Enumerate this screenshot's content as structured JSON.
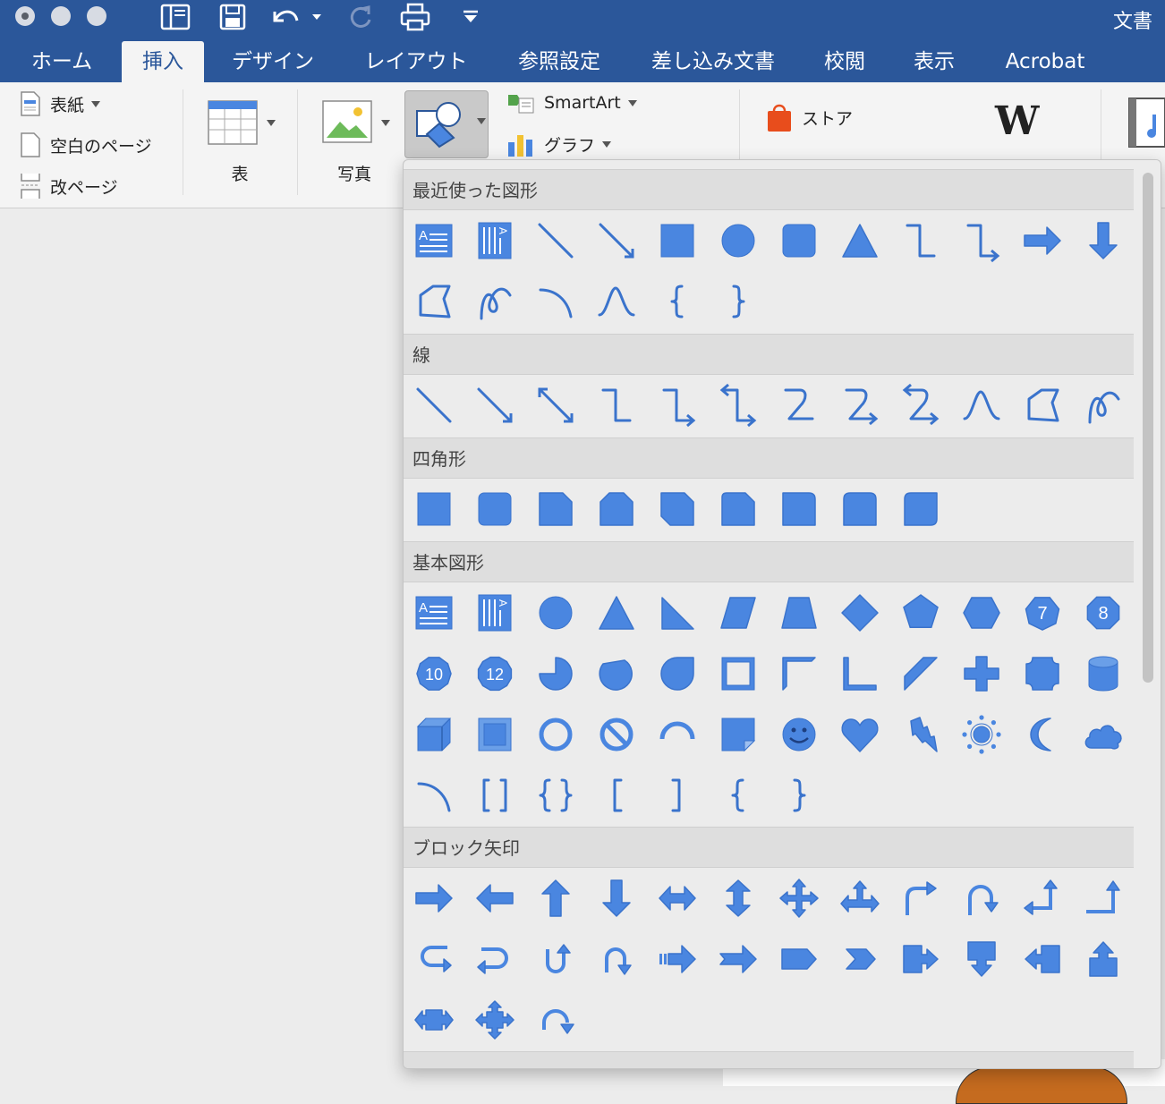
{
  "window": {
    "title": "文書"
  },
  "quick_access": [
    {
      "icon": "sidebar-icon"
    },
    {
      "icon": "save-icon"
    },
    {
      "icon": "undo-icon"
    },
    {
      "icon": "undo-dropdown-icon"
    },
    {
      "icon": "redo-icon"
    },
    {
      "icon": "print-icon"
    },
    {
      "icon": "customize-dropdown-icon"
    }
  ],
  "tabs": [
    {
      "label": "ホーム"
    },
    {
      "label": "挿入",
      "active": true
    },
    {
      "label": "デザイン"
    },
    {
      "label": "レイアウト"
    },
    {
      "label": "参照設定"
    },
    {
      "label": "差し込み文書"
    },
    {
      "label": "校閲"
    },
    {
      "label": "表示"
    },
    {
      "label": "Acrobat"
    }
  ],
  "ribbon": {
    "cover_page": "表紙",
    "blank_page": "空白のページ",
    "page_break": "改ページ",
    "table": "表",
    "picture": "写真",
    "smartart": "SmartArt",
    "chart": "グラフ",
    "store": "ストア"
  },
  "colors": {
    "titlebar": "#2b579a",
    "shape_fill": "#4a86e0",
    "shape_stroke": "#3a73cc"
  },
  "gallery": {
    "sections": [
      {
        "title": "最近使った図形",
        "shapes": [
          "text-box",
          "vertical-text-box",
          "line",
          "line-arrow",
          "rectangle",
          "oval",
          "rounded-rectangle",
          "triangle",
          "elbow-connector",
          "elbow-arrow-connector",
          "right-arrow",
          "down-arrow",
          "freeform",
          "scribble",
          "arc",
          "wave-curve",
          "left-brace",
          "right-brace"
        ]
      },
      {
        "title": "線",
        "shapes": [
          "line",
          "line-arrow",
          "line-double-arrow",
          "elbow-connector",
          "elbow-arrow-connector",
          "elbow-double-arrow-connector",
          "curved-connector",
          "curved-arrow-connector",
          "curved-double-arrow-connector",
          "curve",
          "freeform",
          "scribble"
        ]
      },
      {
        "title": "四角形",
        "shapes": [
          "rectangle",
          "rounded-rectangle",
          "snip-single-corner-rectangle",
          "snip-same-side-corner-rectangle",
          "snip-diagonal-corner-rectangle",
          "snip-round-single-corner-rectangle",
          "round-single-corner-rectangle",
          "round-same-side-corner-rectangle",
          "round-diagonal-corner-rectangle"
        ]
      },
      {
        "title": "基本図形",
        "shapes": [
          "text-box",
          "vertical-text-box",
          "oval",
          "isosceles-triangle",
          "right-triangle",
          "parallelogram",
          "trapezoid",
          "diamond",
          "pentagon",
          "hexagon",
          "heptagon",
          "octagon",
          "decagon",
          "dodecagon",
          "pie",
          "chord",
          "teardrop",
          "frame",
          "half-frame",
          "l-shape",
          "diagonal-stripe",
          "cross",
          "plaque",
          "can",
          "cube",
          "bevel",
          "donut",
          "no-symbol",
          "block-arc",
          "folded-corner",
          "smiley-face",
          "heart",
          "lightning-bolt",
          "sun",
          "moon",
          "cloud",
          "arc",
          "double-bracket",
          "double-brace",
          "left-bracket",
          "right-bracket",
          "left-brace",
          "right-brace"
        ]
      },
      {
        "title": "ブロック矢印",
        "shapes": [
          "right-arrow",
          "left-arrow",
          "up-arrow",
          "down-arrow",
          "left-right-arrow",
          "up-down-arrow",
          "quad-arrow",
          "left-right-up-arrow",
          "bent-arrow",
          "u-turn-arrow",
          "left-up-arrow",
          "bent-up-arrow",
          "curved-right-arrow",
          "curved-left-arrow",
          "curved-up-arrow",
          "curved-down-arrow",
          "striped-right-arrow",
          "notched-right-arrow",
          "pentagon-arrow",
          "chevron",
          "right-arrow-callout",
          "down-arrow-callout",
          "left-arrow-callout",
          "up-arrow-callout",
          "left-right-arrow-callout",
          "quad-arrow-callout",
          "circular-arrow"
        ]
      }
    ],
    "polygon_numbers": {
      "heptagon": "7",
      "octagon": "8",
      "decagon": "10",
      "dodecagon": "12"
    }
  }
}
